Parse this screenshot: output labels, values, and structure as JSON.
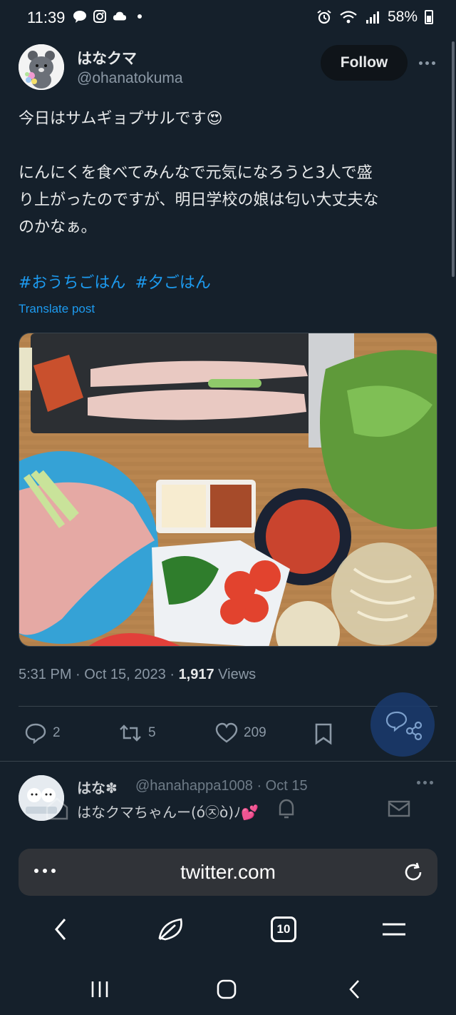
{
  "status_bar": {
    "time": "11:39",
    "battery": "58%"
  },
  "tweet": {
    "display_name": "はなクマ",
    "handle": "@ohanatokuma",
    "follow_label": "Follow",
    "text_line1": "今日はサムギョプサルです",
    "text_line1_emoji": "😍",
    "text_para2_line1": "にんにくを食べてみんなで元気になろうと3人で盛",
    "text_para2_line2": "り上がったのですが、明日学校の娘は匂い大丈夫な",
    "text_para2_line3": "のかなぁ。",
    "hashtags": [
      "#おうちごはん",
      "#夕ごはん"
    ],
    "translate_label": "Translate post",
    "timestamp": "5:31 PM · Oct 15, 2023 · ",
    "views_count": "1,917",
    "views_label": " Views",
    "replies_count": "2",
    "retweets_count": "5",
    "likes_count": "209"
  },
  "reply": {
    "name": "はな✽",
    "meta": "@hanahappa1008 · Oct 15",
    "text": "はなクマちゃんー(ó㉨ò)ﾉ💕"
  },
  "browser": {
    "url": "twitter.com",
    "tab_count": "10"
  },
  "colors": {
    "background": "#15202b",
    "accent": "#1d9bf0",
    "muted": "#8b98a5"
  }
}
